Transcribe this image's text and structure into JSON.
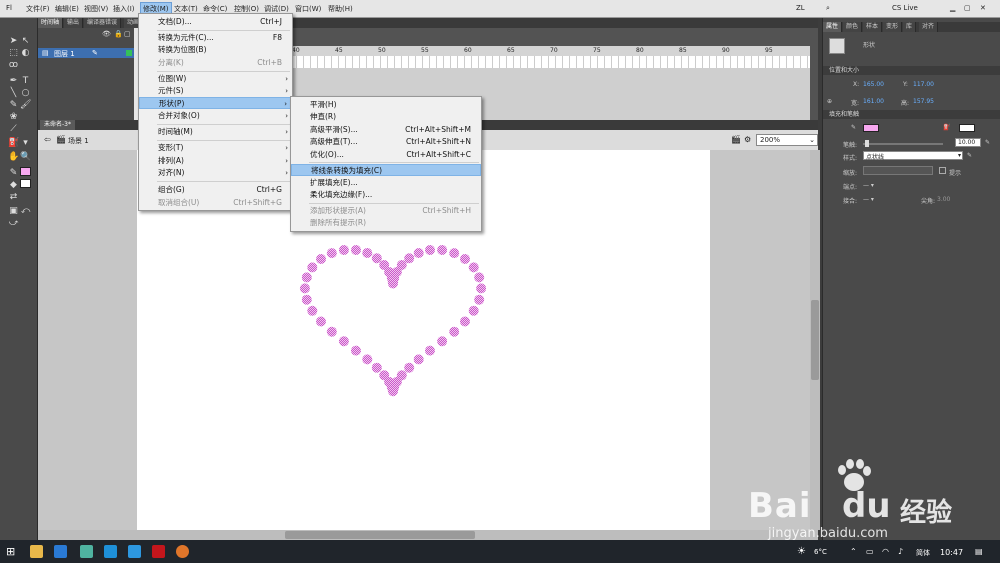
{
  "menubar": {
    "items": [
      "文件(F)",
      "编辑(E)",
      "视图(V)",
      "插入(I)",
      "修改(M)",
      "文本(T)",
      "命令(C)",
      "控制(O)",
      "调试(D)",
      "窗口(W)",
      "帮助(H)"
    ],
    "user": "ZL",
    "cs_live": "CS Live"
  },
  "timeline": {
    "tabs": [
      "时间轴",
      "输出",
      "编译器错误",
      "动画"
    ],
    "layer_name": "图层 1",
    "ruler_numbers": [
      "40",
      "45",
      "50",
      "55",
      "60",
      "65",
      "70",
      "75",
      "80",
      "85",
      "90",
      "95"
    ]
  },
  "document": {
    "tab": "未命名-3*",
    "scene": "场景 1",
    "zoom": "200%"
  },
  "modify_menu": {
    "items": [
      {
        "label": "文档(D)...",
        "shortcut": "Ctrl+J",
        "enabled": true,
        "submenu": false
      },
      {
        "label": "转换为元件(C)...",
        "shortcut": "F8",
        "enabled": true,
        "submenu": false
      },
      {
        "label": "转换为位图(B)",
        "shortcut": "",
        "enabled": true,
        "submenu": false
      },
      {
        "label": "分离(K)",
        "shortcut": "Ctrl+B",
        "enabled": false,
        "submenu": false
      },
      {
        "label": "位图(W)",
        "shortcut": "",
        "enabled": true,
        "submenu": true
      },
      {
        "label": "元件(S)",
        "shortcut": "",
        "enabled": true,
        "submenu": true
      },
      {
        "label": "形状(P)",
        "shortcut": "",
        "enabled": true,
        "submenu": true,
        "highlighted": true
      },
      {
        "label": "合并对象(O)",
        "shortcut": "",
        "enabled": true,
        "submenu": true
      },
      {
        "label": "时间轴(M)",
        "shortcut": "",
        "enabled": true,
        "submenu": true
      },
      {
        "label": "变形(T)",
        "shortcut": "",
        "enabled": true,
        "submenu": true
      },
      {
        "label": "排列(A)",
        "shortcut": "",
        "enabled": true,
        "submenu": true
      },
      {
        "label": "对齐(N)",
        "shortcut": "",
        "enabled": true,
        "submenu": true
      },
      {
        "label": "组合(G)",
        "shortcut": "Ctrl+G",
        "enabled": true,
        "submenu": false
      },
      {
        "label": "取消组合(U)",
        "shortcut": "Ctrl+Shift+G",
        "enabled": false,
        "submenu": false
      }
    ]
  },
  "shape_submenu": {
    "items": [
      {
        "label": "平滑(H)",
        "shortcut": "",
        "enabled": true
      },
      {
        "label": "伸直(R)",
        "shortcut": "",
        "enabled": true
      },
      {
        "label": "高级平滑(S)...",
        "shortcut": "Ctrl+Alt+Shift+M",
        "enabled": true
      },
      {
        "label": "高级伸直(T)...",
        "shortcut": "Ctrl+Alt+Shift+N",
        "enabled": true
      },
      {
        "label": "优化(O)...",
        "shortcut": "Ctrl+Alt+Shift+C",
        "enabled": true
      },
      {
        "label": "将线条转换为填充(C)",
        "shortcut": "",
        "enabled": true,
        "highlighted": true
      },
      {
        "label": "扩展填充(E)...",
        "shortcut": "",
        "enabled": true
      },
      {
        "label": "柔化填充边缘(F)...",
        "shortcut": "",
        "enabled": true
      },
      {
        "label": "添加形状提示(A)",
        "shortcut": "Ctrl+Shift+H",
        "enabled": false
      },
      {
        "label": "删除所有提示(R)",
        "shortcut": "",
        "enabled": false
      }
    ]
  },
  "properties": {
    "tabs": [
      "属性",
      "颜色",
      "样本",
      "变形",
      "库",
      "对齐"
    ],
    "object_type": "形状",
    "section_position": "位置和大小",
    "x_label": "X:",
    "x_value": "165.00",
    "y_label": "Y:",
    "y_value": "117.00",
    "w_label": "宽:",
    "w_value": "161.00",
    "h_label": "高:",
    "h_value": "157.95",
    "section_fill": "填充和笔触",
    "stroke_label": "笔触:",
    "stroke_value": "10.00",
    "style_label": "样式:",
    "style_value": "点状线",
    "scale_label": "缩放:",
    "hint_label": "提示",
    "cap_label": "端点:",
    "join_label": "接合:",
    "miter_label": "尖角:",
    "miter_value": "3.00",
    "stroke_color": "#f7a8f0"
  },
  "taskbar": {
    "temperature": "6°C",
    "ime": "简体",
    "time": "10:47"
  },
  "watermark": {
    "brand_text": "Bai",
    "brand_suffix": "du",
    "cn_text": "经验",
    "url": "jingyan.baidu.com"
  },
  "heart": {
    "color": "#d97ad9"
  }
}
